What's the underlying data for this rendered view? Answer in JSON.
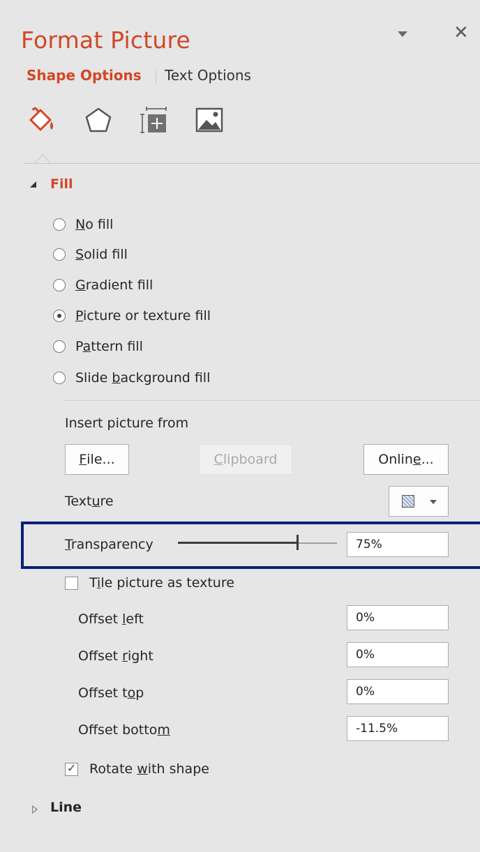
{
  "pane": {
    "title": "Format Picture",
    "pin_icon": "chevron-down-icon",
    "close_icon": "close-icon",
    "close_glyph": "✕"
  },
  "tabs": [
    {
      "label": "Shape Options",
      "active": true
    },
    {
      "label": "Text Options",
      "active": false
    }
  ],
  "icon_tabs": [
    {
      "name": "fill-line-icon",
      "active": true
    },
    {
      "name": "effects-icon",
      "active": false
    },
    {
      "name": "size-properties-icon",
      "active": false
    },
    {
      "name": "picture-icon",
      "active": false
    }
  ],
  "fill": {
    "label": "Fill",
    "expanded": true,
    "options": [
      {
        "pre": "",
        "u": "N",
        "post": "o fill",
        "selected": false
      },
      {
        "pre": "",
        "u": "S",
        "post": "olid fill",
        "selected": false
      },
      {
        "pre": "",
        "u": "G",
        "post": "radient fill",
        "selected": false
      },
      {
        "pre": "",
        "u": "P",
        "post": "icture or texture fill",
        "selected": true
      },
      {
        "pre": "P",
        "u": "a",
        "post": "ttern fill",
        "selected": false
      },
      {
        "pre": "Slide ",
        "u": "b",
        "post": "ackground fill",
        "selected": false
      }
    ],
    "insert_label": "Insert picture from",
    "buttons": {
      "file": {
        "u": "F",
        "post": "ile..."
      },
      "clipboard": {
        "u": "C",
        "post": "lipboard",
        "disabled": true
      },
      "online": {
        "pre": "Onlin",
        "u": "e",
        "post": "..."
      }
    },
    "texture": {
      "pre": "Text",
      "u": "u",
      "post": "re"
    },
    "transparency": {
      "pre": "",
      "u": "T",
      "post": "ransparency",
      "value": "75%",
      "level": 0.75
    },
    "tile": {
      "pre": "T",
      "u": "i",
      "post": "le picture as texture",
      "checked": false
    },
    "offsets": [
      {
        "pre": "Offset ",
        "u": "l",
        "post": "eft",
        "value": "0%"
      },
      {
        "pre": "Offset ",
        "u": "r",
        "post": "ight",
        "value": "0%"
      },
      {
        "pre": "Offset t",
        "u": "o",
        "post": "p",
        "value": "0%"
      },
      {
        "pre": "Offset botto",
        "u": "m",
        "post": "",
        "value": "-11.5%"
      }
    ],
    "rotate": {
      "pre": "Rotate ",
      "u": "w",
      "post": "ith shape",
      "checked": true
    }
  },
  "line": {
    "label": "Line",
    "expanded": false
  },
  "colors": {
    "accent": "#d24726",
    "highlight": "#0b1f7a",
    "background": "#e6e6e6"
  }
}
